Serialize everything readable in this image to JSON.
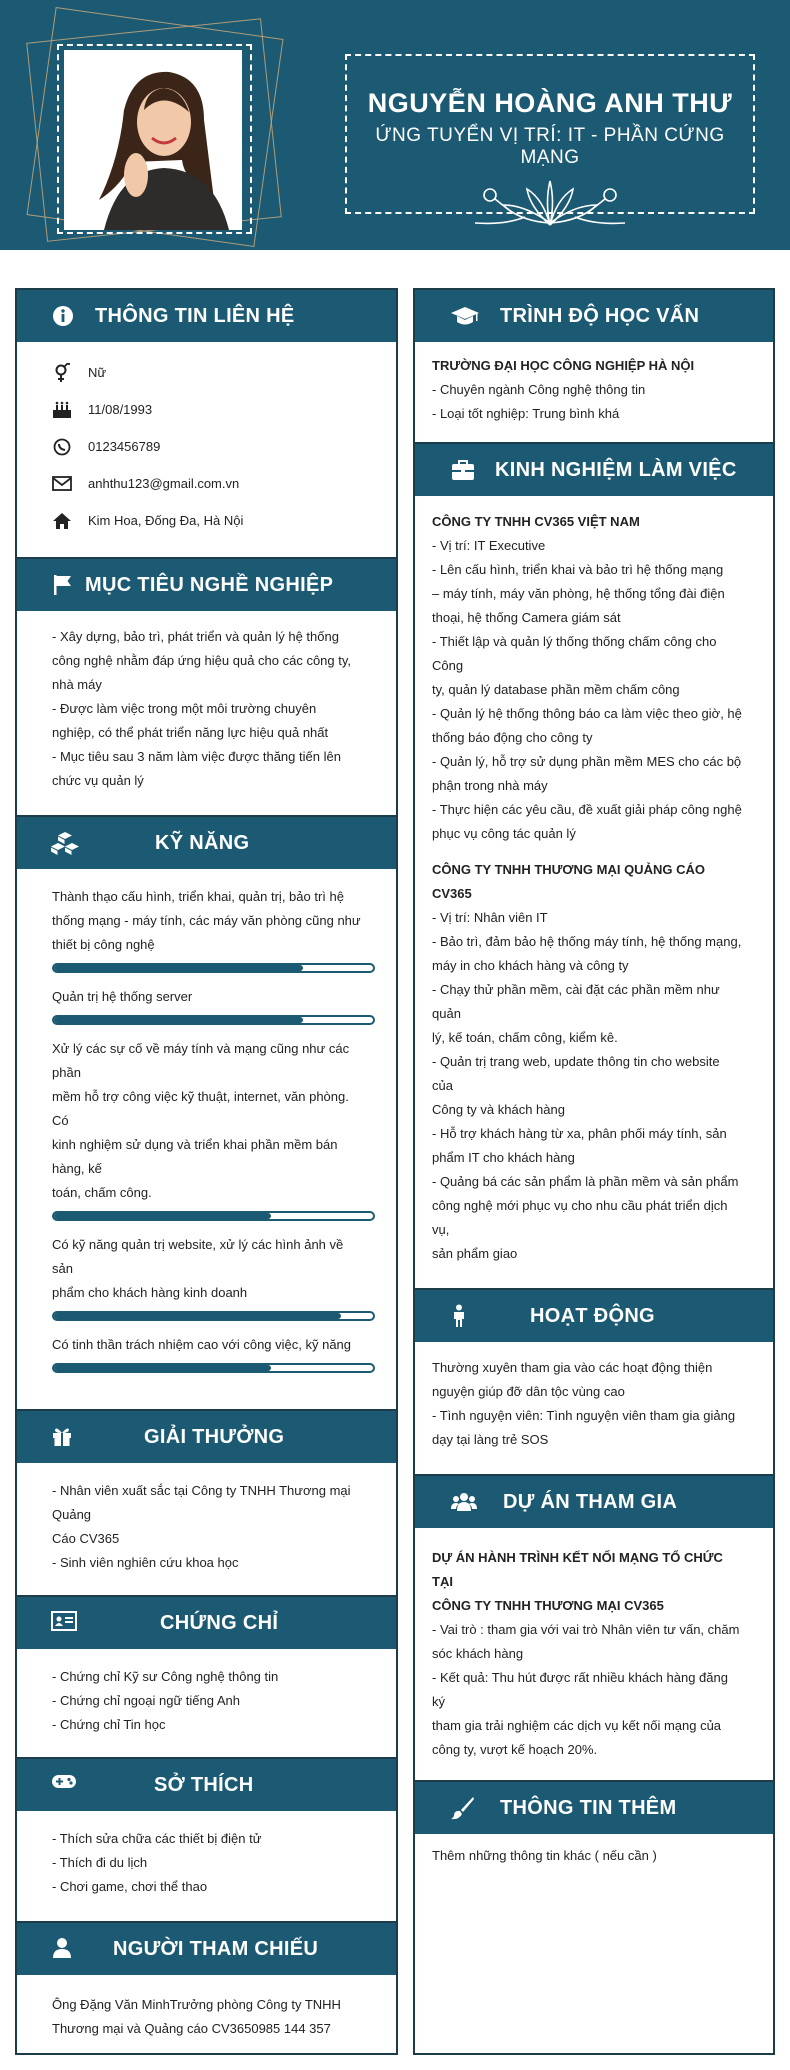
{
  "header": {
    "name": "NGUYỄN HOÀNG ANH THƯ",
    "position": "ỨNG TUYỂN VỊ TRÍ: IT - PHẦN CỨNG MẠNG"
  },
  "colors": {
    "primary": "#1c5a73",
    "border": "#1c3c4a",
    "gold": "#c9a87a"
  },
  "contact": {
    "title": "THÔNG TIN LIÊN HỆ",
    "items": [
      {
        "icon": "gender-icon",
        "text": "Nữ"
      },
      {
        "icon": "birthday-cake-icon",
        "text": "11/08/1993"
      },
      {
        "icon": "whatsapp-phone-icon",
        "text": "0123456789"
      },
      {
        "icon": "envelope-icon",
        "text": "anhthu123@gmail.com.vn"
      },
      {
        "icon": "home-icon",
        "text": "Kim Hoa, Đống Đa, Hà Nội"
      }
    ]
  },
  "objective": {
    "title": "MỤC TIÊU NGHỀ NGHIỆP",
    "lines": [
      "- Xây dựng, bảo trì, phát triển và quản lý hệ thống",
      "công nghệ nhằm đáp ứng hiệu quả cho các công ty,",
      "nhà máy",
      "- Được làm việc trong một môi trường chuyên",
      "nghiệp, có thể phát triển năng lực hiệu quả nhất",
      "- Mục tiêu sau 3 năm làm việc được thăng tiến lên",
      "chức vụ quản lý"
    ]
  },
  "skills": {
    "title": "KỸ NĂNG",
    "items": [
      {
        "lines": [
          "Thành thạo cấu hình, triển khai, quản trị, bảo trì hệ",
          "thống mạng - máy tính, các máy văn phòng cũng như",
          "thiết bị công nghệ"
        ],
        "level": 0.78
      },
      {
        "lines": [
          "Quản trị hệ thống server"
        ],
        "level": 0.78
      },
      {
        "lines": [
          "Xử lý các sự cố về máy tính và mạng cũng như các phần",
          "mềm hỗ trợ công việc kỹ thuật, internet, văn phòng. Có",
          "kinh nghiệm sử dụng và triển khai phần mềm bán hàng, kế",
          "toán, chấm công."
        ],
        "level": 0.68
      },
      {
        "lines": [
          "Có kỹ năng quản trị website, xử lý các hình ảnh về sản",
          "phẩm cho khách hàng kinh doanh"
        ],
        "level": 0.9
      },
      {
        "lines": [
          "Có tinh thần trách nhiệm cao với công việc, kỹ năng"
        ],
        "level": 0.68
      }
    ]
  },
  "awards": {
    "title": "GIẢI THƯỞNG",
    "lines": [
      "- Nhân viên xuất sắc tại Công ty TNHH Thương mại Quảng",
      "Cáo CV365",
      "- Sinh viên nghiên cứu khoa học"
    ]
  },
  "certificates": {
    "title": "CHỨNG CHỈ",
    "lines": [
      "- Chứng chỉ Kỹ sư Công nghệ thông tin",
      "- Chứng chỉ ngoại ngữ tiếng Anh",
      "- Chứng chỉ Tin học"
    ]
  },
  "hobbies": {
    "title": "SỞ THÍCH",
    "lines": [
      "- Thích sửa chữa các thiết bị điện tử",
      "- Thích đi du lịch",
      "- Chơi game, chơi thể thao"
    ]
  },
  "references": {
    "title": "NGƯỜI THAM CHIẾU",
    "lines": [
      "Ông Đặng Văn MinhTrưởng phòng Công ty TNHH",
      "Thương mại và Quảng cáo CV3650985 144 357"
    ]
  },
  "education": {
    "title": "TRÌNH ĐỘ HỌC VẤN",
    "school": "TRƯỜNG ĐẠI HỌC CÔNG NGHIỆP HÀ NỘI",
    "lines": [
      "- Chuyên ngành Công nghệ thông tin",
      "- Loại tốt nghiệp: Trung bình khá"
    ]
  },
  "experience": {
    "title": "KINH NGHIỆM LÀM VIỆC",
    "jobs": [
      {
        "company": [
          "CÔNG TY TNHH CV365 VIỆT NAM"
        ],
        "lines": [
          "- Vị trí: IT Executive",
          "- Lên cấu hình, triển khai và bảo trì hệ thống mạng",
          "– máy tính, máy văn phòng, hệ thống tổng đài điện",
          "thoại, hệ thống Camera giám sát",
          "- Thiết lập và quản lý thống thống chấm công cho Công",
          "ty, quản lý database phần mềm chấm công",
          "- Quản lý hệ thống thông báo ca làm việc theo giờ, hệ",
          "thống báo động cho công ty",
          "- Quản lý, hỗ trợ sử dụng phần mềm MES cho các bộ",
          "phận trong nhà máy",
          "- Thực hiện các yêu cầu, đề xuất giải pháp công nghệ",
          "phục vụ công tác quản lý"
        ]
      },
      {
        "company": [
          "CÔNG TY TNHH THƯƠNG MẠI QUẢNG CÁO",
          "CV365"
        ],
        "lines": [
          "- Vị trí: Nhân viên IT",
          "- Bảo trì, đảm bảo hệ thống máy tính, hệ thống mạng,",
          "máy in cho khách hàng và công ty",
          "- Chạy thử phần mềm, cài đặt các phần mềm như quản",
          "lý, kế toán, chấm công, kiểm kê.",
          "- Quản trị trang web, update thông tin cho website của",
          "Công ty và khách hàng",
          "- Hỗ trợ khách hàng từ xa, phân phối máy tính, sản",
          "phẩm IT cho khách hàng",
          "- Quảng bá các sản phẩm là phần mềm và sản phẩm",
          "công nghệ mới phục vụ cho nhu cầu phát triển dịch vụ,",
          "sản phẩm giao"
        ]
      }
    ]
  },
  "activities": {
    "title": "HOẠT ĐỘNG",
    "lines": [
      "Thường xuyên tham gia vào các hoạt động thiện",
      "nguyện giúp đỡ dân tộc vùng cao",
      "- Tình nguyện viên:  Tình nguyện viên tham gia giảng",
      "dạy tại làng trẻ SOS"
    ]
  },
  "projects": {
    "title": "DỰ ÁN THAM GIA",
    "heading": [
      "DỰ ÁN HÀNH TRÌNH KẾT NỐI MẠNG TỔ CHỨC TẠI",
      "CÔNG TY TNHH THƯƠNG MẠI CV365"
    ],
    "lines": [
      "- Vai trò : tham gia với vai trò Nhân viên tư vấn, chăm",
      "sóc khách hàng",
      "- Kết quả: Thu hút được rất nhiều khách hàng đăng ký",
      "tham gia trải nghiệm các dịch vụ kết nối mạng của",
      "công ty, vượt kế hoạch 20%."
    ]
  },
  "additional": {
    "title": "THÔNG TIN THÊM",
    "lines": [
      "Thêm những thông tin khác ( nếu cần )"
    ]
  }
}
